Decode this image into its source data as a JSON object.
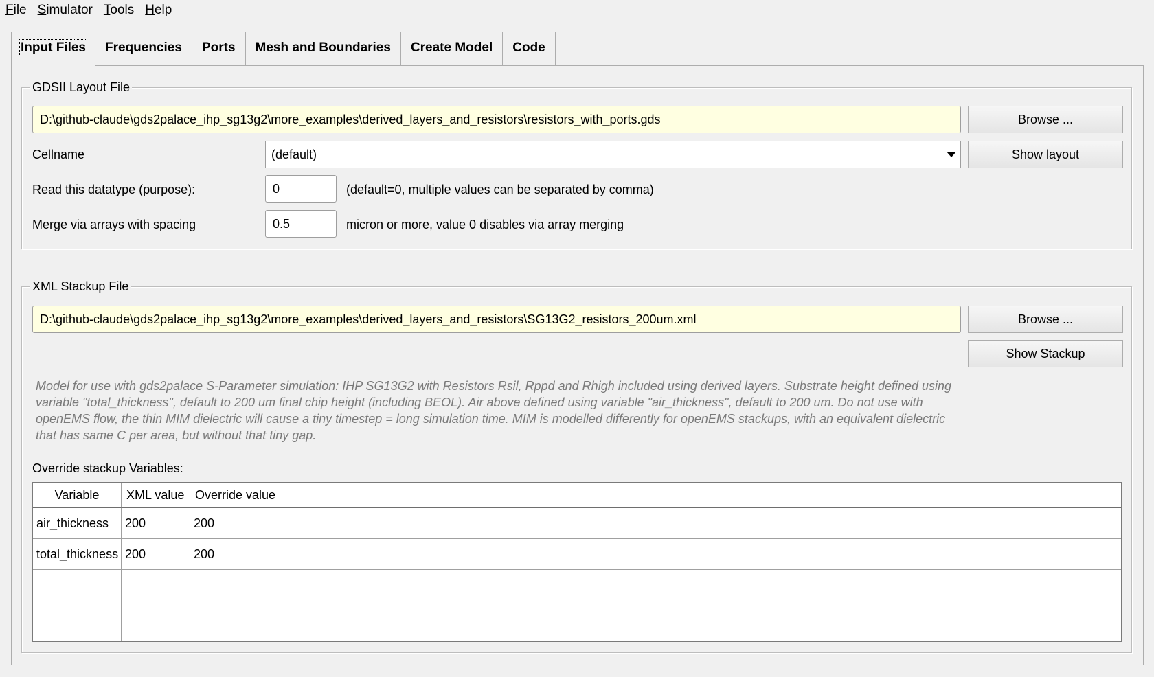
{
  "menu": {
    "items": [
      {
        "accel": "F",
        "rest": "ile"
      },
      {
        "accel": "S",
        "rest": "imulator"
      },
      {
        "accel": "T",
        "rest": "ools"
      },
      {
        "accel": "H",
        "rest": "elp"
      }
    ]
  },
  "tabs": [
    {
      "label": "Input Files",
      "active": true
    },
    {
      "label": "Frequencies"
    },
    {
      "label": "Ports"
    },
    {
      "label": "Mesh and Boundaries"
    },
    {
      "label": "Create Model"
    },
    {
      "label": "Code"
    }
  ],
  "gds": {
    "group_title": "GDSII Layout File",
    "file_path": "D:\\github-claude\\gds2palace_ihp_sg13g2\\more_examples\\derived_layers_and_resistors\\resistors_with_ports.gds",
    "browse_label": "Browse ...",
    "cellname_label": "Cellname",
    "cellname_value": "(default)",
    "show_layout_label": "Show layout",
    "datatype_label": "Read this datatype (purpose):",
    "datatype_value": "0",
    "datatype_hint": "(default=0, multiple values can be separated by comma)",
    "merge_label": "Merge via arrays with spacing",
    "merge_value": "0.5",
    "merge_hint": "micron or more, value 0 disables via array merging"
  },
  "xml": {
    "group_title": "XML Stackup File",
    "file_path": "D:\\github-claude\\gds2palace_ihp_sg13g2\\more_examples\\derived_layers_and_resistors\\SG13G2_resistors_200um.xml",
    "browse_label": "Browse ...",
    "show_stackup_label": "Show Stackup",
    "description": "Model for use with gds2palace S-Parameter simulation: IHP SG13G2 with Resistors Rsil, Rppd and Rhigh included using derived layers. Substrate height defined using variable \"total_thickness\", default to 200 um final chip height (including BEOL). Air above defined using variable \"air_thickness\", default to 200 um. Do not use with openEMS flow, the thin MIM dielectric will cause a tiny timestep = long simulation time. MIM is modelled differently for openEMS stackups, with an equivalent dielectric that has same C per area, but without that tiny gap.",
    "override_label": "Override stackup Variables:",
    "table": {
      "headers": [
        "Variable",
        "XML value",
        "Override value"
      ],
      "rows": [
        [
          "air_thickness",
          "200",
          "200"
        ],
        [
          "total_thickness",
          "200",
          "200"
        ]
      ]
    }
  }
}
